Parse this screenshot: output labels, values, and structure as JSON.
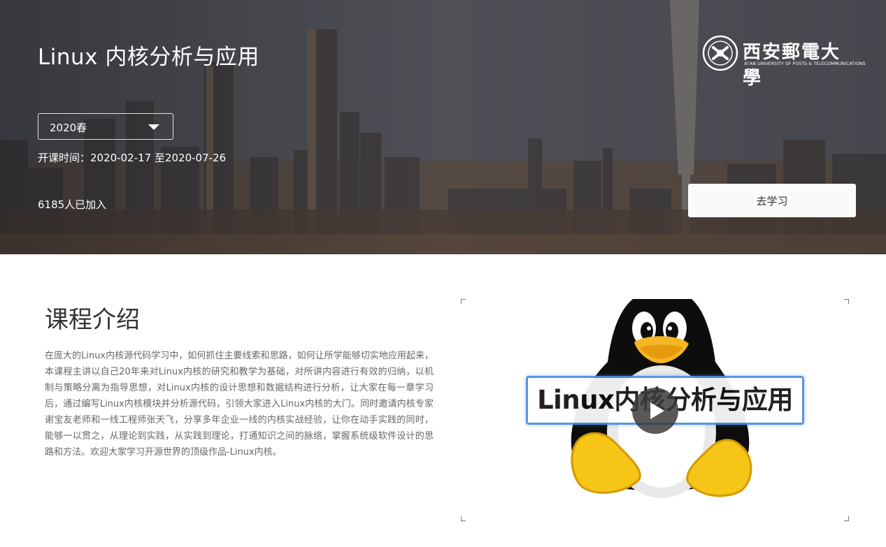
{
  "header": {
    "course_title": "Linux 内核分析与应用",
    "university": {
      "name_cn": "西安郵電大學",
      "name_en": "XI'AN UNIVERSITY OF POSTS & TELECOMMUNICATIONS"
    },
    "term_select": {
      "selected": "2020春",
      "icon": "caret-down-icon"
    },
    "period": {
      "label": "开课时间：",
      "value": "2020-02-17 至2020-07-26"
    },
    "enrolled": "6185人已加入",
    "go_study_label": "去学习"
  },
  "intro": {
    "heading": "课程介绍",
    "body": "在庞大的Linux内核源代码学习中，如何抓住主要线索和思路，如何让所学能够切实地应用起来，本课程主讲以自己20年来对Linux内核的研究和教学为基础，对所讲内容进行有效的归纳，以机制与策略分离为指导思想，对Linux内核的设计思想和数据结构进行分析，让大家在每一章学习后，通过编写Linux内核模块并分析源代码，引领大家进入Linux内核的大门。同时邀请内核专家谢宝友老师和一线工程师张天飞，分享多年企业一线的内核实战经验，让你在动手实践的同时，能够一以贯之，从理论到实践，从实践到理论，打通知识之间的脉络，掌握系统级软件设计的思路和方法。欢迎大家学习开源世界的顶级作品-Linux内核。"
  },
  "video": {
    "banner_text": "Linux内核分析与应用",
    "icon": "play-icon",
    "accent": "#4a8fe3"
  }
}
